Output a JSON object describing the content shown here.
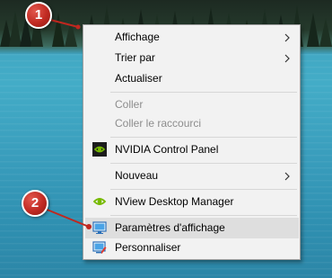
{
  "context_menu": {
    "items": [
      {
        "label": "Affichage",
        "submenu": true
      },
      {
        "label": "Trier par",
        "submenu": true
      },
      {
        "label": "Actualiser"
      },
      {
        "label": "Coller",
        "disabled": true
      },
      {
        "label": "Coller le raccourci",
        "disabled": true
      },
      {
        "label": "NVIDIA Control Panel",
        "icon": "nvidia-icon"
      },
      {
        "label": "Nouveau",
        "submenu": true
      },
      {
        "label": "NView Desktop Manager",
        "icon": "nview-icon"
      },
      {
        "label": "Paramètres d'affichage",
        "icon": "display-settings-icon",
        "highlighted": true
      },
      {
        "label": "Personnaliser",
        "icon": "personalize-icon"
      }
    ]
  },
  "annotations": {
    "marker_1": "1",
    "marker_2": "2",
    "color": "#c0271f"
  }
}
